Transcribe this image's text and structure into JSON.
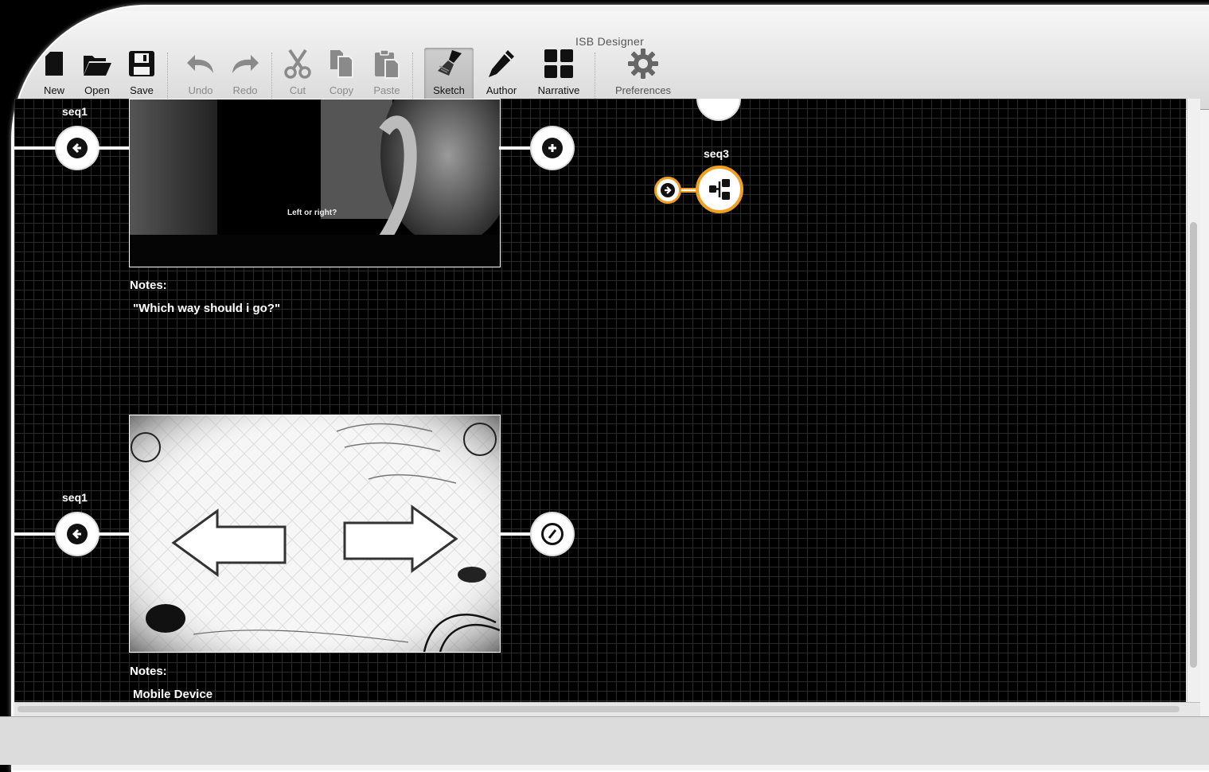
{
  "app": {
    "title": "ISB Designer"
  },
  "toolbar": {
    "new": "New",
    "open": "Open",
    "save": "Save",
    "undo": "Undo",
    "redo": "Redo",
    "cut": "Cut",
    "copy": "Copy",
    "paste": "Paste",
    "sketch": "Sketch",
    "author": "Author",
    "narrative": "Narrative",
    "preferences": "Preferences",
    "active_mode": "Sketch"
  },
  "canvas": {
    "scenes": [
      {
        "sequence": "seq1",
        "notes_label": "Notes:",
        "notes": "\"Which way should i go?\"",
        "caption": "Left or right?",
        "out_icon": "plus-circle-icon"
      },
      {
        "sequence": "seq1",
        "notes_label": "Notes:",
        "notes": "Mobile Device",
        "out_icon": "no-entry-icon"
      }
    ],
    "branch_node": {
      "sequence": "seq3",
      "color": "#f0a020"
    }
  }
}
